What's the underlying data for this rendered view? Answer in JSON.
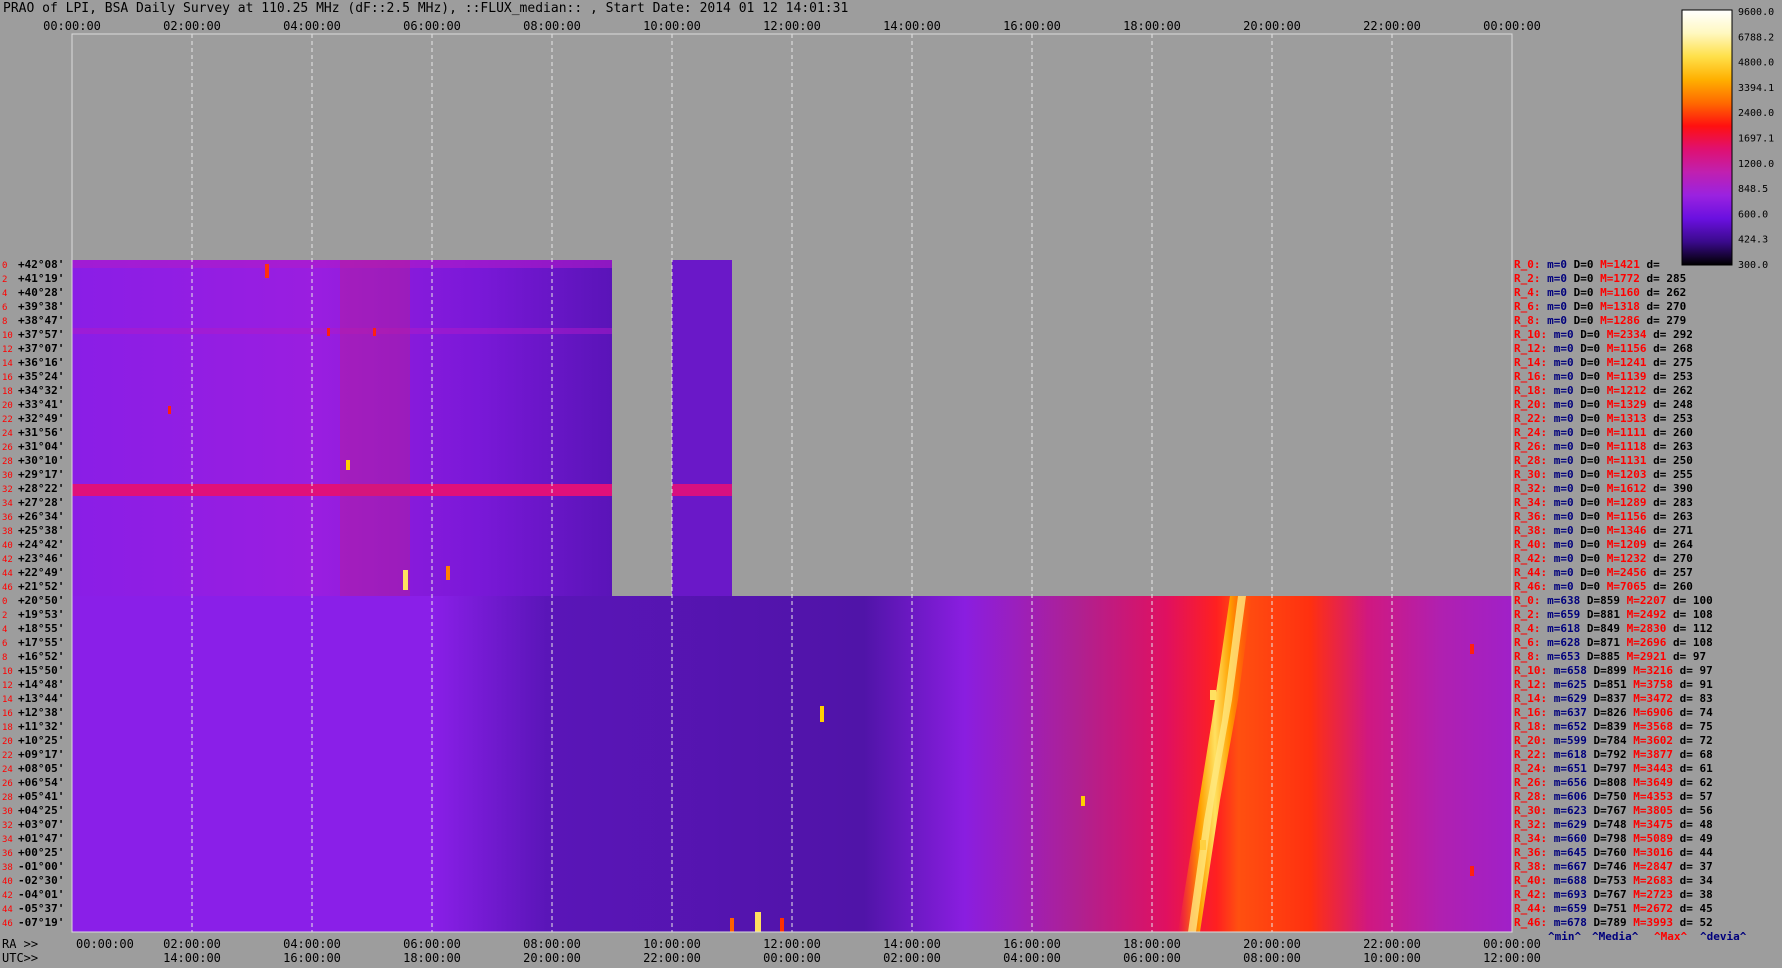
{
  "title": "PRAO of LPI, BSA Daily Survey at 110.25 MHz (dF::2.5 MHz), ::FLUX_median:: , Start Date: 2014 01 12 14:01:31",
  "chart_data": {
    "type": "heatmap",
    "top_axis": [
      "00:00:00",
      "02:00:00",
      "04:00:00",
      "06:00:00",
      "08:00:00",
      "10:00:00",
      "12:00:00",
      "14:00:00",
      "16:00:00",
      "18:00:00",
      "20:00:00",
      "22:00:00",
      "00:00:00"
    ],
    "bottom_axis_label_top": "RA >>",
    "bottom_axis_label_bottom": "UTC>>",
    "bottom_axis_ra": [
      "00:00:00",
      "02:00:00",
      "04:00:00",
      "06:00:00",
      "08:00:00",
      "10:00:00",
      "12:00:00",
      "14:00:00",
      "16:00:00",
      "18:00:00",
      "20:00:00",
      "22:00:00",
      "00:00:00"
    ],
    "bottom_axis_utc": [
      "14:00:00",
      "16:00:00",
      "18:00:00",
      "20:00:00",
      "22:00:00",
      "00:00:00",
      "02:00:00",
      "04:00:00",
      "06:00:00",
      "08:00:00",
      "10:00:00",
      "12:00:00"
    ],
    "row_numbers_block1": [
      "0",
      "2",
      "4",
      "6",
      "8",
      "10",
      "12",
      "14",
      "16",
      "18",
      "20",
      "22",
      "24",
      "26",
      "28",
      "30",
      "32",
      "34",
      "36",
      "38",
      "40",
      "42",
      "44",
      "46"
    ],
    "row_numbers_block2": [
      "0",
      "2",
      "4",
      "6",
      "8",
      "10",
      "12",
      "14",
      "16",
      "18",
      "20",
      "22",
      "24",
      "26",
      "28",
      "30",
      "32",
      "34",
      "36",
      "38",
      "40",
      "42",
      "44",
      "46"
    ],
    "declinations_block1": [
      "+42°08'",
      "+41°19'",
      "+40°28'",
      "+39°38'",
      "+38°47'",
      "+37°57'",
      "+37°07'",
      "+36°16'",
      "+35°24'",
      "+34°32'",
      "+33°41'",
      "+32°49'",
      "+31°56'",
      "+31°04'",
      "+30°10'",
      "+29°17'",
      "+28°22'",
      "+27°28'",
      "+26°34'",
      "+25°38'",
      "+24°42'",
      "+23°46'",
      "+22°49'",
      "+21°52'"
    ],
    "declinations_block2": [
      "+20°50'",
      "+19°53'",
      "+18°55'",
      "+17°55'",
      "+16°52'",
      "+15°50'",
      "+14°48'",
      "+13°44'",
      "+12°38'",
      "+11°32'",
      "+10°25'",
      "+09°17'",
      "+08°05'",
      "+06°54'",
      "+05°41'",
      "+04°25'",
      "+03°07'",
      "+01°47'",
      "+00°25'",
      "-01°00'",
      "-02°30'",
      "-04°01'",
      "-05°37'",
      "-07°19'"
    ],
    "stats_block1": [
      {
        "r": "R_0:",
        "m": "m=0",
        "D": "D=0",
        "M": "M=1421",
        "d": "d="
      },
      {
        "r": "R_2:",
        "m": "m=0",
        "D": "D=0",
        "M": "M=1772",
        "d": "d= 285"
      },
      {
        "r": "R_4:",
        "m": "m=0",
        "D": "D=0",
        "M": "M=1160",
        "d": "d= 262"
      },
      {
        "r": "R_6:",
        "m": "m=0",
        "D": "D=0",
        "M": "M=1318",
        "d": "d= 270"
      },
      {
        "r": "R_8:",
        "m": "m=0",
        "D": "D=0",
        "M": "M=1286",
        "d": "d= 279"
      },
      {
        "r": "R_10:",
        "m": "m=0",
        "D": "D=0",
        "M": "M=2334",
        "d": "d= 292"
      },
      {
        "r": "R_12:",
        "m": "m=0",
        "D": "D=0",
        "M": "M=1156",
        "d": "d= 268"
      },
      {
        "r": "R_14:",
        "m": "m=0",
        "D": "D=0",
        "M": "M=1241",
        "d": "d= 275"
      },
      {
        "r": "R_16:",
        "m": "m=0",
        "D": "D=0",
        "M": "M=1139",
        "d": "d= 253"
      },
      {
        "r": "R_18:",
        "m": "m=0",
        "D": "D=0",
        "M": "M=1212",
        "d": "d= 262"
      },
      {
        "r": "R_20:",
        "m": "m=0",
        "D": "D=0",
        "M": "M=1329",
        "d": "d= 248"
      },
      {
        "r": "R_22:",
        "m": "m=0",
        "D": "D=0",
        "M": "M=1313",
        "d": "d= 253"
      },
      {
        "r": "R_24:",
        "m": "m=0",
        "D": "D=0",
        "M": "M=1111",
        "d": "d= 260"
      },
      {
        "r": "R_26:",
        "m": "m=0",
        "D": "D=0",
        "M": "M=1118",
        "d": "d= 263"
      },
      {
        "r": "R_28:",
        "m": "m=0",
        "D": "D=0",
        "M": "M=1131",
        "d": "d= 250"
      },
      {
        "r": "R_30:",
        "m": "m=0",
        "D": "D=0",
        "M": "M=1203",
        "d": "d= 255"
      },
      {
        "r": "R_32:",
        "m": "m=0",
        "D": "D=0",
        "M": "M=1612",
        "d": "d= 390"
      },
      {
        "r": "R_34:",
        "m": "m=0",
        "D": "D=0",
        "M": "M=1289",
        "d": "d= 283"
      },
      {
        "r": "R_36:",
        "m": "m=0",
        "D": "D=0",
        "M": "M=1156",
        "d": "d= 263"
      },
      {
        "r": "R_38:",
        "m": "m=0",
        "D": "D=0",
        "M": "M=1346",
        "d": "d= 271"
      },
      {
        "r": "R_40:",
        "m": "m=0",
        "D": "D=0",
        "M": "M=1209",
        "d": "d= 264"
      },
      {
        "r": "R_42:",
        "m": "m=0",
        "D": "D=0",
        "M": "M=1232",
        "d": "d= 270"
      },
      {
        "r": "R_44:",
        "m": "m=0",
        "D": "D=0",
        "M": "M=2456",
        "d": "d= 257"
      },
      {
        "r": "R_46:",
        "m": "m=0",
        "D": "D=0",
        "M": "M=7065",
        "d": "d= 260"
      }
    ],
    "stats_block2": [
      {
        "r": "R_0:",
        "m": "m=638",
        "D": "D=859",
        "M": "M=2207",
        "d": "d= 100"
      },
      {
        "r": "R_2:",
        "m": "m=659",
        "D": "D=881",
        "M": "M=2492",
        "d": "d= 108"
      },
      {
        "r": "R_4:",
        "m": "m=618",
        "D": "D=849",
        "M": "M=2830",
        "d": "d= 112"
      },
      {
        "r": "R_6:",
        "m": "m=628",
        "D": "D=871",
        "M": "M=2696",
        "d": "d= 108"
      },
      {
        "r": "R_8:",
        "m": "m=653",
        "D": "D=885",
        "M": "M=2921",
        "d": "d= 97"
      },
      {
        "r": "R_10:",
        "m": "m=658",
        "D": "D=899",
        "M": "M=3216",
        "d": "d= 97"
      },
      {
        "r": "R_12:",
        "m": "m=625",
        "D": "D=851",
        "M": "M=3758",
        "d": "d= 91"
      },
      {
        "r": "R_14:",
        "m": "m=629",
        "D": "D=837",
        "M": "M=3472",
        "d": "d= 83"
      },
      {
        "r": "R_16:",
        "m": "m=637",
        "D": "D=826",
        "M": "M=6906",
        "d": "d= 74"
      },
      {
        "r": "R_18:",
        "m": "m=652",
        "D": "D=839",
        "M": "M=3568",
        "d": "d= 75"
      },
      {
        "r": "R_20:",
        "m": "m=599",
        "D": "D=784",
        "M": "M=3602",
        "d": "d= 72"
      },
      {
        "r": "R_22:",
        "m": "m=618",
        "D": "D=792",
        "M": "M=3877",
        "d": "d= 68"
      },
      {
        "r": "R_24:",
        "m": "m=651",
        "D": "D=797",
        "M": "M=3443",
        "d": "d= 61"
      },
      {
        "r": "R_26:",
        "m": "m=656",
        "D": "D=808",
        "M": "M=3649",
        "d": "d= 62"
      },
      {
        "r": "R_28:",
        "m": "m=606",
        "D": "D=750",
        "M": "M=4353",
        "d": "d= 57"
      },
      {
        "r": "R_30:",
        "m": "m=623",
        "D": "D=767",
        "M": "M=3805",
        "d": "d= 56"
      },
      {
        "r": "R_32:",
        "m": "m=629",
        "D": "D=748",
        "M": "M=3475",
        "d": "d= 48"
      },
      {
        "r": "R_34:",
        "m": "m=660",
        "D": "D=798",
        "M": "M=5089",
        "d": "d= 49"
      },
      {
        "r": "R_36:",
        "m": "m=645",
        "D": "D=760",
        "M": "M=3016",
        "d": "d= 44"
      },
      {
        "r": "R_38:",
        "m": "m=667",
        "D": "D=746",
        "M": "M=2847",
        "d": "d= 37"
      },
      {
        "r": "R_40:",
        "m": "m=688",
        "D": "D=753",
        "M": "M=2683",
        "d": "d= 34"
      },
      {
        "r": "R_42:",
        "m": "m=693",
        "D": "D=767",
        "M": "M=2723",
        "d": "d= 38"
      },
      {
        "r": "R_44:",
        "m": "m=659",
        "D": "D=751",
        "M": "M=2672",
        "d": "d= 45"
      },
      {
        "r": "R_46:",
        "m": "m=678",
        "D": "D=789",
        "M": "M=3993",
        "d": "d= 52"
      }
    ],
    "stats_footer": [
      "^min^",
      "^Media^",
      "^Max^",
      "^devia^"
    ],
    "colorbar_ticks": [
      "9600.0",
      "6788.2",
      "4800.0",
      "3394.1",
      "2400.0",
      "1697.1",
      "1200.0",
      "848.5",
      "600.0",
      "424.3",
      "300.0"
    ],
    "colorbar_colors": [
      "#000000",
      "#3a0a8c",
      "#6a10e0",
      "#9a22e0",
      "#c020b0",
      "#e01070",
      "#ff1010",
      "#ff6a00",
      "#ffb000",
      "#ffe04a",
      "#fff8c0",
      "#ffffff"
    ],
    "colors": {
      "background": "#9d9d9d",
      "stat_label": "#ff0000",
      "stat_value": "#00007c",
      "row_num": "#ff0000"
    }
  }
}
